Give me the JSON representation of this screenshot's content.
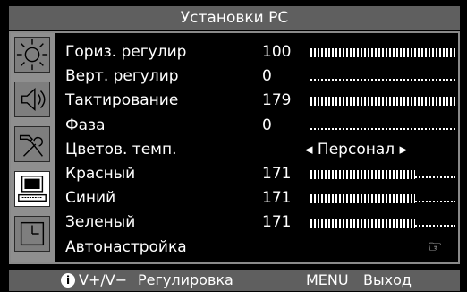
{
  "title": "Установки PC",
  "icons": [
    "brightness-icon",
    "speaker-icon",
    "tools-icon",
    "pc-monitor-icon",
    "clock-icon"
  ],
  "selected_icon": 3,
  "rows": [
    {
      "label": "Гориз. регулир",
      "value": "100",
      "level": 1.0
    },
    {
      "label": "Верт. регулир",
      "value": "0",
      "level": 0.0
    },
    {
      "label": "Тактирование",
      "value": "179",
      "level": 1.0
    },
    {
      "label": "Фаза",
      "value": "0",
      "level": 0.0
    },
    {
      "label": "Цветов. темп.",
      "option": "◂ Персонал ▸"
    },
    {
      "label": "Красный",
      "value": "171",
      "level": 0.72
    },
    {
      "label": "Синий",
      "value": "171",
      "level": 0.72
    },
    {
      "label": "Зеленый",
      "value": "171",
      "level": 0.72
    },
    {
      "label": "Автонастройка",
      "hand": "☞"
    }
  ],
  "footer": {
    "hint1": "V+/V−",
    "hint1_action": "Регулировка",
    "hint2": "MENU",
    "hint2_action": "Выход",
    "info_glyph": "i"
  }
}
